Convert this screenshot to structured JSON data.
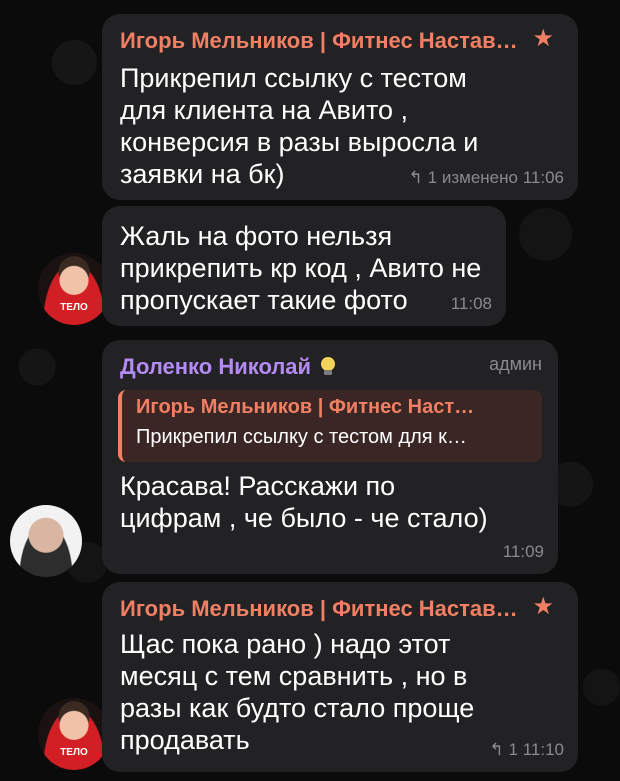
{
  "messages": [
    {
      "sender": "Игорь Мельников | Фитнес Настав…",
      "text": "Прикрепил ссылку с тестом\nдля клиента на Авито ,\nконверсия в разы выросла и\nзаявки на бк)",
      "replies": "1",
      "edited": "изменено",
      "time": "11:06"
    },
    {
      "text": "Жаль на фото нельзя\nприкрепить кр код , Авито не\nпропускает такие фото",
      "time": "11:08",
      "avatar_tag": "ТЕЛО"
    },
    {
      "sender": "Доленко Николай",
      "role": "админ",
      "reply_name": "Игорь Мельников | Фитнес Наст…",
      "reply_text": "Прикрепил ссылку с тестом для к…",
      "text": "Красава! Расскажи по\nцифрам , че было - че стало)",
      "time": "11:09"
    },
    {
      "sender": "Игорь Мельников | Фитнес Настав…",
      "text": "Щас пока рано ) надо этот\nмесяц с тем сравнить , но в\nразы как будто стало проще\nпродавать",
      "replies": "1",
      "time": "11:10",
      "avatar_tag": "ТЕЛО"
    }
  ],
  "icons": {
    "reply_icon": "reply-arrow-icon",
    "badge_icon": "star-icon",
    "emoji_icon": "lightbulb-icon"
  },
  "colors": {
    "accent": "#f07f63",
    "bubble": "#222224",
    "background": "#0b0b0b",
    "meta": "#8a8a8e"
  }
}
